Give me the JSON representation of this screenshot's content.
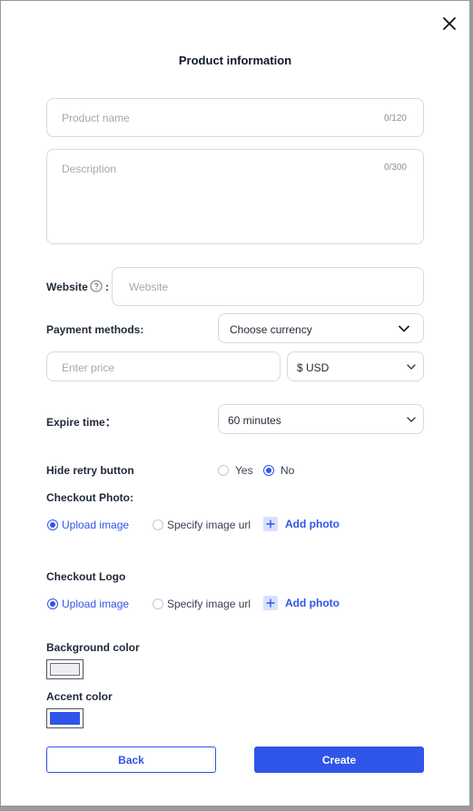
{
  "dialog": {
    "title": "Product information",
    "close_icon": "close-icon"
  },
  "product_name": {
    "placeholder": "Product name",
    "counter": "0/120"
  },
  "description": {
    "placeholder": "Description",
    "counter": "0/300"
  },
  "website": {
    "label": "Website",
    "colon": ":",
    "placeholder": "Website",
    "help_icon": "help-circle-icon"
  },
  "payment": {
    "label": "Payment methods:",
    "currency_placeholder": "Choose currency",
    "price_placeholder": "Enter price",
    "currency_value": "$ USD"
  },
  "expire": {
    "label": "Expire time：",
    "value": "60 minutes"
  },
  "hide_retry": {
    "label": "Hide retry button",
    "options": [
      {
        "label": "Yes",
        "selected": false
      },
      {
        "label": "No",
        "selected": true
      }
    ]
  },
  "checkout_photo": {
    "label": "Checkout Photo:",
    "options": [
      {
        "label": "Upload image",
        "selected": true
      },
      {
        "label": "Specify image url",
        "selected": false
      }
    ],
    "add_label": "Add photo"
  },
  "checkout_logo": {
    "label": "Checkout Logo",
    "options": [
      {
        "label": "Upload image",
        "selected": true
      },
      {
        "label": "Specify image url",
        "selected": false
      }
    ],
    "add_label": "Add photo"
  },
  "background_color": {
    "label": "Background color",
    "value": "#eeeeee"
  },
  "accent_color": {
    "label": "Accent color",
    "value": "#2f55e9"
  },
  "buttons": {
    "back": "Back",
    "create": "Create"
  },
  "colors": {
    "accent": "#2f55e9",
    "border": "#d6d9df"
  }
}
